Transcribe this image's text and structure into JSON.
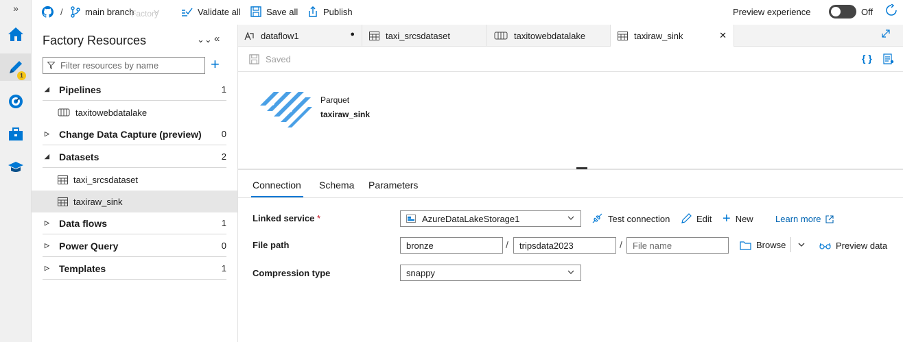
{
  "topbar": {
    "repo_separator": "/",
    "branch": "main branch",
    "factory_ghost": "Factory",
    "validate_all": "Validate all",
    "save_all": "Save all",
    "publish": "Publish",
    "preview_experience": "Preview experience",
    "preview_toggle": "Off"
  },
  "rail": {
    "collapse": "»",
    "author_badge": "1"
  },
  "resources": {
    "title": "Factory Resources",
    "filter_placeholder": "Filter resources by name",
    "sections": [
      {
        "label": "Pipelines",
        "count": "1"
      },
      {
        "label": "Change Data Capture (preview)",
        "count": "0"
      },
      {
        "label": "Datasets",
        "count": "2"
      },
      {
        "label": "Data flows",
        "count": "1"
      },
      {
        "label": "Power Query",
        "count": "0"
      },
      {
        "label": "Templates",
        "count": "1"
      }
    ],
    "pipeline_items": [
      "taxitowebdatalake"
    ],
    "dataset_items": [
      "taxi_srcsdataset",
      "taxiraw_sink"
    ]
  },
  "tabs": [
    {
      "label": "dataflow1",
      "marker": "●"
    },
    {
      "label": "taxi_srcsdataset"
    },
    {
      "label": "taxitowebdatalake"
    },
    {
      "label": "taxiraw_sink",
      "marker": "✕"
    }
  ],
  "command": {
    "saved": "Saved"
  },
  "canvas": {
    "type_label": "Parquet",
    "name": "taxiraw_sink"
  },
  "properties": {
    "tabs": [
      "Connection",
      "Schema",
      "Parameters"
    ],
    "linked_service_label": "Linked service",
    "required_marker": "*",
    "linked_service_value": "AzureDataLakeStorage1",
    "test_connection": "Test connection",
    "edit": "Edit",
    "new": "New",
    "learn_more": "Learn more",
    "file_path_label": "File path",
    "path_container": "bronze",
    "path_directory": "tripsdata2023",
    "path_file_placeholder": "File name",
    "path_separator": "/",
    "browse": "Browse",
    "preview_data": "Preview data",
    "compression_label": "Compression type",
    "compression_value": "snappy"
  },
  "colors": {
    "accent": "#0078d4",
    "parquet_icon": "#4aa0e6",
    "badge": "#f5c518"
  }
}
